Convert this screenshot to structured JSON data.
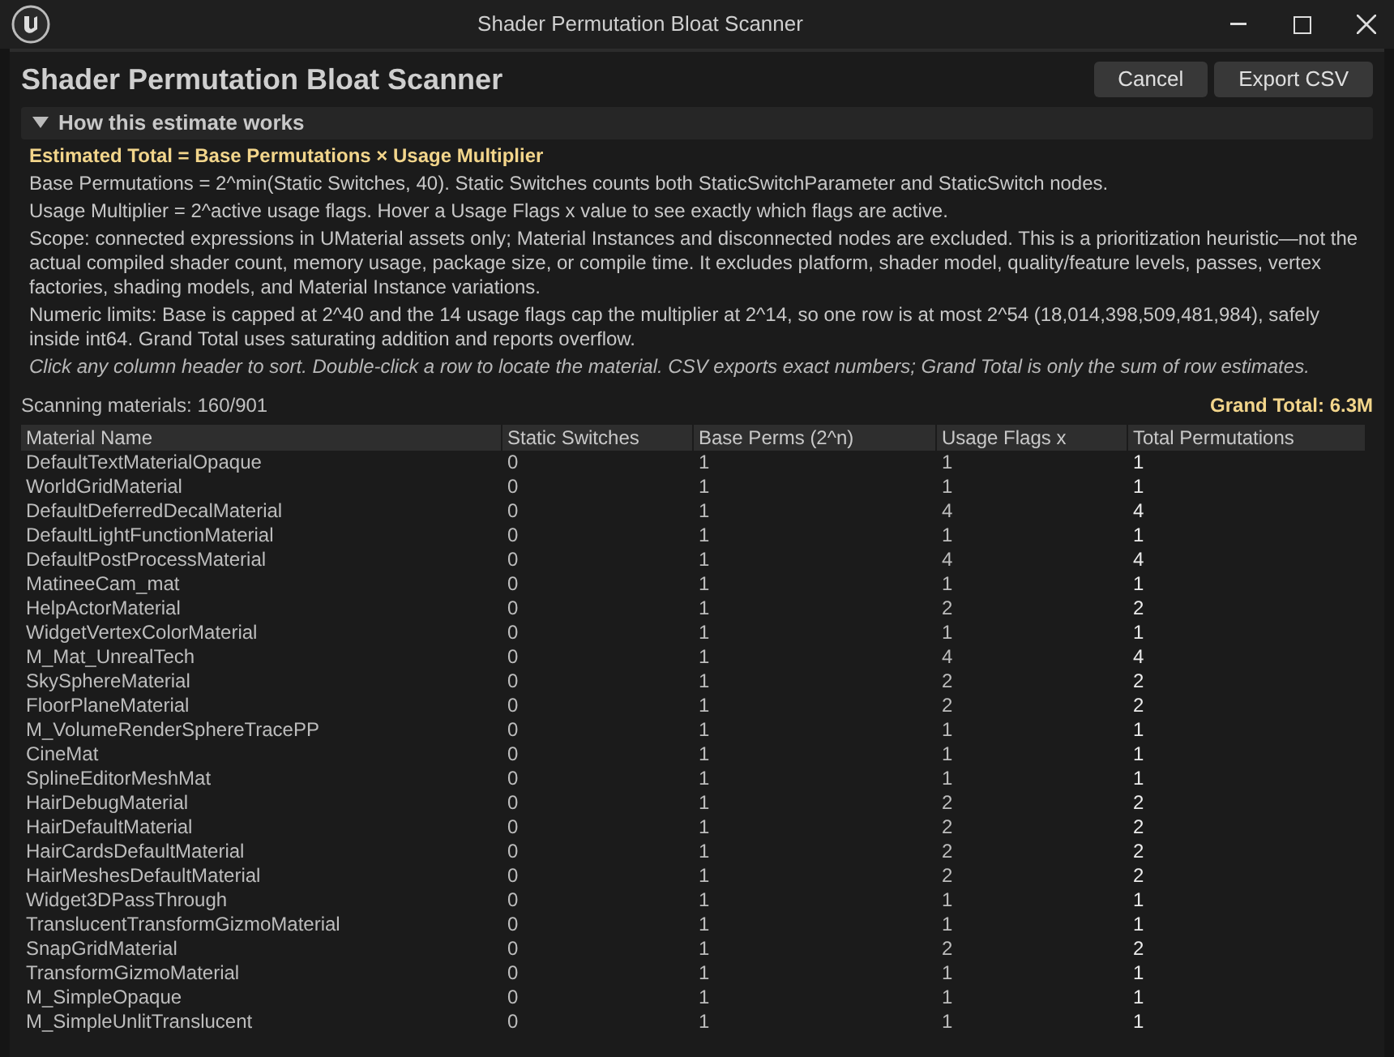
{
  "window": {
    "title": "Shader Permutation Bloat Scanner"
  },
  "header": {
    "title": "Shader Permutation Bloat Scanner",
    "buttons": [
      "Cancel",
      "Export CSV"
    ]
  },
  "explainer": {
    "label": "How this estimate works",
    "expanded": true,
    "formula": "Estimated Total = Base Permutations × Usage Multiplier",
    "paragraphs": [
      "Base Permutations = 2^min(Static Switches, 40). Static Switches counts both StaticSwitchParameter and StaticSwitch nodes.",
      "Usage Multiplier = 2^active usage flags. Hover a Usage Flags x value to see exactly which flags are active.",
      "Scope: connected expressions in UMaterial assets only; Material Instances and disconnected nodes are excluded. This is a prioritization heuristic—not the actual compiled shader count, memory usage, package size, or compile time. It excludes platform, shader model, quality/feature levels, passes, vertex factories, shading models, and Material Instance variations.",
      "Numeric limits: Base is capped at 2^40 and the 14 usage flags cap the multiplier at 2^14, so one row is at most 2^54 (18,014,398,509,481,984), safely inside int64. Grand Total uses saturating addition and reports overflow."
    ],
    "hint": "Click any column header to sort. Double-click a row to locate the material. CSV exports exact numbers; Grand Total is only the sum of row estimates."
  },
  "status": {
    "progress": "Scanning materials: 160/901",
    "grand_total": "Grand Total: 6.3M"
  },
  "table": {
    "columns": [
      "Material Name",
      "Static Switches",
      "Base Perms (2^n)",
      "Usage Flags x",
      "Total Permutations"
    ],
    "rows": [
      [
        "DefaultTextMaterialOpaque",
        "0",
        "1",
        "1",
        "1"
      ],
      [
        "WorldGridMaterial",
        "0",
        "1",
        "1",
        "1"
      ],
      [
        "DefaultDeferredDecalMaterial",
        "0",
        "1",
        "4",
        "4"
      ],
      [
        "DefaultLightFunctionMaterial",
        "0",
        "1",
        "1",
        "1"
      ],
      [
        "DefaultPostProcessMaterial",
        "0",
        "1",
        "4",
        "4"
      ],
      [
        "MatineeCam_mat",
        "0",
        "1",
        "1",
        "1"
      ],
      [
        "HelpActorMaterial",
        "0",
        "1",
        "2",
        "2"
      ],
      [
        "WidgetVertexColorMaterial",
        "0",
        "1",
        "1",
        "1"
      ],
      [
        "M_Mat_UnrealTech",
        "0",
        "1",
        "4",
        "4"
      ],
      [
        "SkySphereMaterial",
        "0",
        "1",
        "2",
        "2"
      ],
      [
        "FloorPlaneMaterial",
        "0",
        "1",
        "2",
        "2"
      ],
      [
        "M_VolumeRenderSphereTracePP",
        "0",
        "1",
        "1",
        "1"
      ],
      [
        "CineMat",
        "0",
        "1",
        "1",
        "1"
      ],
      [
        "SplineEditorMeshMat",
        "0",
        "1",
        "1",
        "1"
      ],
      [
        "HairDebugMaterial",
        "0",
        "1",
        "2",
        "2"
      ],
      [
        "HairDefaultMaterial",
        "0",
        "1",
        "2",
        "2"
      ],
      [
        "HairCardsDefaultMaterial",
        "0",
        "1",
        "2",
        "2"
      ],
      [
        "HairMeshesDefaultMaterial",
        "0",
        "1",
        "2",
        "2"
      ],
      [
        "Widget3DPassThrough",
        "0",
        "1",
        "1",
        "1"
      ],
      [
        "TranslucentTransformGizmoMaterial",
        "0",
        "1",
        "1",
        "1"
      ],
      [
        "SnapGridMaterial",
        "0",
        "1",
        "2",
        "2"
      ],
      [
        "TransformGizmoMaterial",
        "0",
        "1",
        "1",
        "1"
      ],
      [
        "M_SimpleOpaque",
        "0",
        "1",
        "1",
        "1"
      ],
      [
        "M_SimpleUnlitTranslucent",
        "0",
        "1",
        "1",
        "1"
      ]
    ]
  }
}
